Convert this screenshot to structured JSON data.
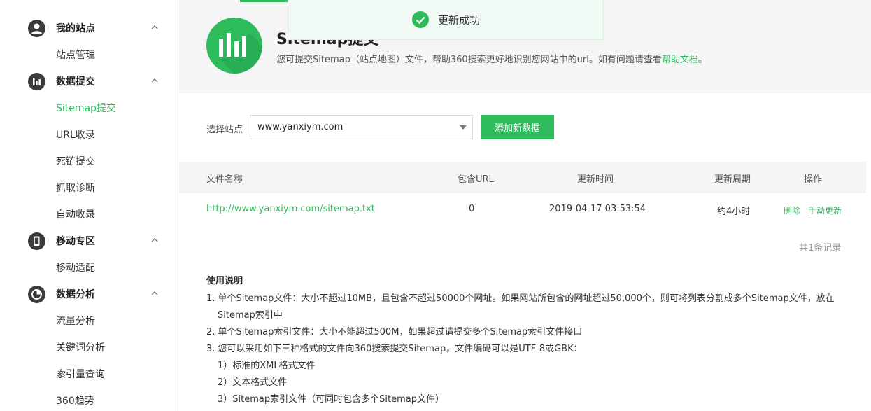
{
  "sidebar": {
    "sections": [
      {
        "title": "我的站点",
        "items": [
          "站点管理"
        ]
      },
      {
        "title": "数据提交",
        "items": [
          "Sitemap提交",
          "URL收录",
          "死链提交",
          "抓取诊断",
          "自动收录"
        ]
      },
      {
        "title": "移动专区",
        "items": [
          "移动适配"
        ]
      },
      {
        "title": "数据分析",
        "items": [
          "流量分析",
          "关键词分析",
          "索引量查询",
          "360趋势"
        ]
      }
    ]
  },
  "header": {
    "title": "Sitemap提交",
    "desc_prefix": "您可提交Sitemap（站点地图）文件，帮助360搜索更好地识别您网站中的url。如有问题请查看",
    "help_link": "帮助文档",
    "desc_suffix": "。"
  },
  "toast": {
    "text": "更新成功"
  },
  "form": {
    "site_label": "选择站点",
    "site_value": "www.yanxiym.com",
    "add_button": "添加新数据"
  },
  "table": {
    "headers": [
      "文件名称",
      "包含URL",
      "更新时间",
      "更新周期",
      "操作"
    ],
    "rows": [
      {
        "file": "http://www.yanxiym.com/sitemap.txt",
        "url_count": "0",
        "updated": "2019-04-17 03:53:54",
        "cycle": "约4小时",
        "delete": "删除",
        "manual_update": "手动更新"
      }
    ],
    "total": "共1条记录"
  },
  "instructions": {
    "title": "使用说明",
    "lines": [
      "1. 单个Sitemap文件：大小不超过10MB，且包含不超过50000个网址。如果网站所包含的网址超过50,000个，则可将列表分割成多个Sitemap文件，放在",
      "Sitemap索引中",
      "2. 单个Sitemap索引文件：大小不能超过500M，如果超过请提交多个Sitemap索引文件接口",
      "3. 您可以采用如下三种格式的文件向360搜索提交Sitemap，文件编码可以是UTF-8或GBK：",
      "1）标准的XML格式文件",
      "2）文本格式文件",
      "3）Sitemap索引文件（可同时包含多个Sitemap文件）"
    ]
  },
  "colors": {
    "accent": "#2ebb5c"
  }
}
